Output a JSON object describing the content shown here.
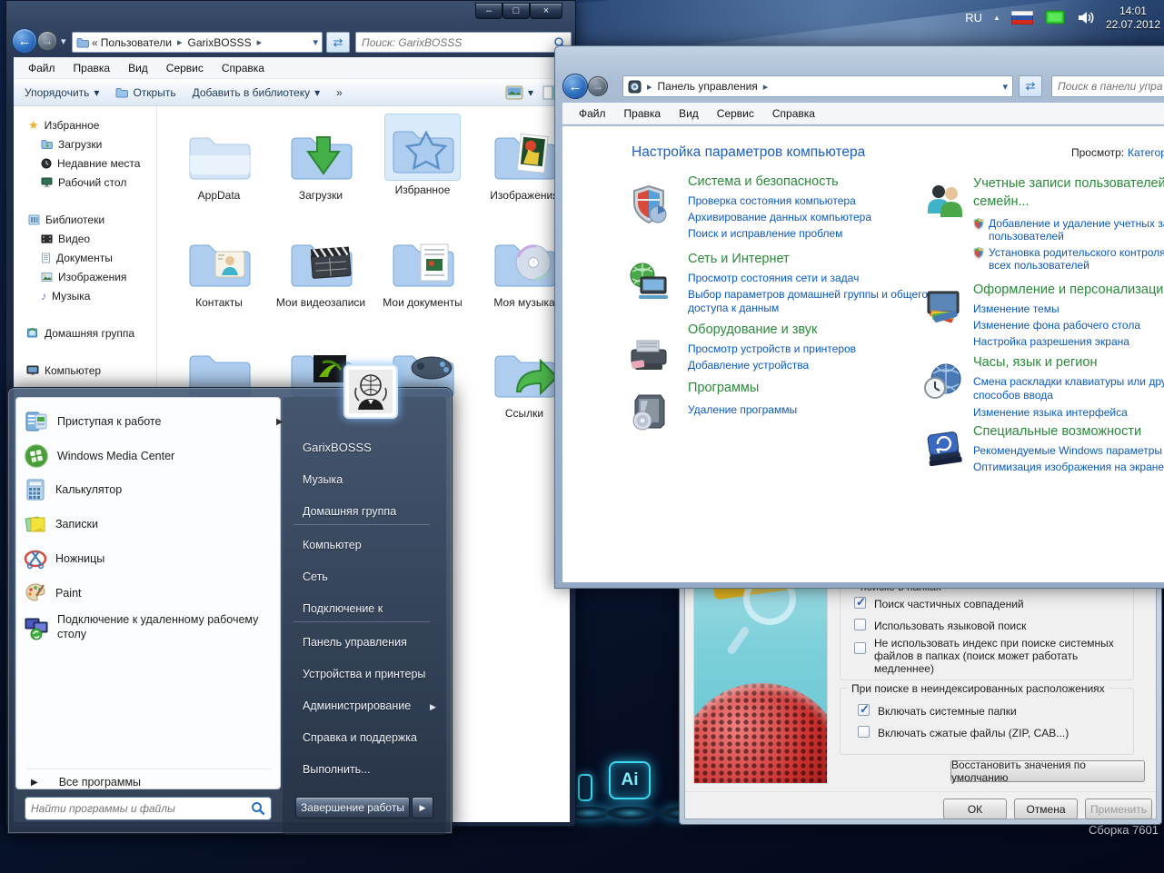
{
  "glyphs": {
    "min": "–",
    "max": "□",
    "close": "×",
    "back": "←",
    "forward": "→",
    "chev_down": "▾",
    "chev_right": "▸",
    "play_right": "▶",
    "tray_expand": "▲",
    "refresh": "⇄",
    "breadcrumb_prefix": "«",
    "music_note": "♪",
    "star": "★"
  },
  "desktop": {
    "watermark": "Сборка 7601",
    "dock_icon_label": "Ai"
  },
  "explorer": {
    "crumb1": "Пользователи",
    "crumb2": "GarixBOSSS",
    "search_placeholder": "Поиск: GarixBOSSS",
    "menu": [
      "Файл",
      "Правка",
      "Вид",
      "Сервис",
      "Справка"
    ],
    "toolbar": {
      "organize": "Упорядочить",
      "open": "Открыть",
      "add_to_library": "Добавить в библиотеку",
      "more": "»"
    },
    "sidebar": {
      "favorites": "Избранное",
      "downloads": "Загрузки",
      "recent": "Недавние места",
      "desktop": "Рабочий стол",
      "libraries": "Библиотеки",
      "video": "Видео",
      "documents": "Документы",
      "images": "Изображения",
      "music": "Музыка",
      "homegroup": "Домашняя группа",
      "computer": "Компьютер"
    },
    "folders": [
      {
        "name": "AppData"
      },
      {
        "name": "Загрузки"
      },
      {
        "name": "Избранное"
      },
      {
        "name": "Изображения"
      },
      {
        "name": "Контакты"
      },
      {
        "name": "Мои видеозаписи"
      },
      {
        "name": "Мои документы"
      },
      {
        "name": "Моя музыка"
      },
      {
        "name": "Ссылки"
      }
    ]
  },
  "control_panel": {
    "address": "Панель управления",
    "search_placeholder": "Поиск в панели упра",
    "menu": [
      "Файл",
      "Правка",
      "Вид",
      "Сервис",
      "Справка"
    ],
    "title": "Настройка параметров компьютера",
    "view_label": "Просмотр:",
    "view_value": "Категория",
    "categories_left": [
      {
        "title": "Система и безопасность",
        "links": [
          "Проверка состояния компьютера",
          "Архивирование данных компьютера",
          "Поиск и исправление проблем"
        ]
      },
      {
        "title": "Сеть и Интернет",
        "links": [
          "Просмотр состояния сети и задач",
          "Выбор параметров домашней группы и общего доступа к данным"
        ]
      },
      {
        "title": "Оборудование и звук",
        "links": [
          "Просмотр устройств и принтеров",
          "Добавление устройства"
        ]
      },
      {
        "title": "Программы",
        "links": [
          "Удаление программы"
        ]
      }
    ],
    "categories_right": [
      {
        "title": "Учетные записи пользователей и семейн...",
        "links": [
          "Добавление и удаление учетных записей пользователей",
          "Установка родительского контроля для всех пользователей"
        ]
      },
      {
        "title": "Оформление и персонализация",
        "links": [
          "Изменение темы",
          "Изменение фона рабочего стола",
          "Настройка разрешения экрана"
        ]
      },
      {
        "title": "Часы, язык и регион",
        "links": [
          "Смена раскладки клавиатуры или других способов ввода",
          "Изменение языка интерфейса"
        ]
      },
      {
        "title": "Специальные возможности",
        "links": [
          "Рекомендуемые Windows параметры",
          "Оптимизация изображения на экране"
        ]
      }
    ]
  },
  "dialog": {
    "clipped_line": "поиске в папках",
    "checkboxes": [
      {
        "label": "Поиск частичных совпадений",
        "checked": true
      },
      {
        "label": "Использовать языковой поиск",
        "checked": false
      },
      {
        "label": "Не использовать индекс при поиске системных файлов в папках (поиск может работать медленнее)",
        "checked": false
      }
    ],
    "group2_title": "При поиске в неиндексированных расположениях",
    "group2_checkboxes": [
      {
        "label": "Включать системные папки",
        "checked": true
      },
      {
        "label": "Включать сжатые файлы (ZIP, CAB...)",
        "checked": false
      }
    ],
    "restore_button": "Восстановить значения по умолчанию",
    "ok": "ОК",
    "cancel": "Отмена",
    "apply": "Применить"
  },
  "start_menu": {
    "user": "GarixBOSSS",
    "left_items": [
      "Приступая к работе",
      "Windows Media Center",
      "Калькулятор",
      "Записки",
      "Ножницы",
      "Paint",
      "Подключение к удаленному рабочему столу"
    ],
    "all_programs": "Все программы",
    "search_placeholder": "Найти программы и файлы",
    "right_items": [
      "GarixBOSSS",
      "Музыка",
      "Домашняя группа",
      "Компьютер",
      "Сеть",
      "Подключение к",
      "Панель управления",
      "Устройства и принтеры",
      "Администрирование",
      "Справка и поддержка",
      "Выполнить..."
    ],
    "shutdown": "Завершение работы"
  },
  "taskbar": {
    "tray": {
      "lang": "RU",
      "time": "14:01",
      "date": "22.07.2012"
    }
  }
}
